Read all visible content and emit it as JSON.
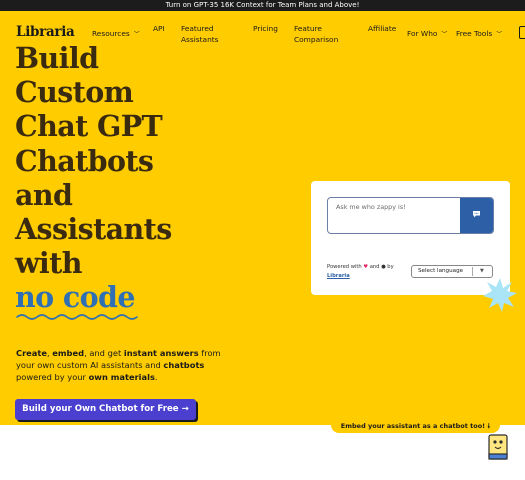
{
  "announcement": "Turn on GPT-35 16K Context for Team Plans and Above!",
  "nav": {
    "logo": "Libraria",
    "resources": "Resources",
    "api": "API",
    "featured_line1": "Featured",
    "featured_line2": "Assistants",
    "pricing": "Pricing",
    "comparison_line1": "Feature",
    "comparison_line2": "Comparison",
    "affiliate": "Affiliate",
    "for_who": "For Who",
    "free_tools": "Free Tools"
  },
  "hero": {
    "headline_lines": [
      "Build",
      "Custom",
      "Chat GPT",
      "Chatbots",
      "and",
      "Assistants",
      "with"
    ],
    "headline_accent": "no code",
    "desc": {
      "create": "Create",
      "comma": ", ",
      "embed": "embed",
      "and_get": ", and get ",
      "instant": "instant answers",
      "from": " from your own custom AI assistants and ",
      "chatbots": "chatbots",
      "powered": " powered by your ",
      "materials": "own materials",
      "period": "."
    },
    "cta_label": "Build your Own Chatbot for Free",
    "cta_arrow": "→"
  },
  "widget": {
    "placeholder": "Ask me who zappy is!",
    "send_icon": "chat-bubble-icon",
    "powered_prefix": "Powered with",
    "powered_and": "and",
    "powered_by": "by",
    "powered_link": "Libraria",
    "language": "Select language"
  },
  "embed_tab": "Embed your assistant as a chatbot too!",
  "colors": {
    "hero_bg": "#ffcc00",
    "cta_bg": "#4a3fcf",
    "accent_text": "#2f6fb3",
    "send_btn": "#2c5fa6",
    "star": "#a9e4f7"
  }
}
